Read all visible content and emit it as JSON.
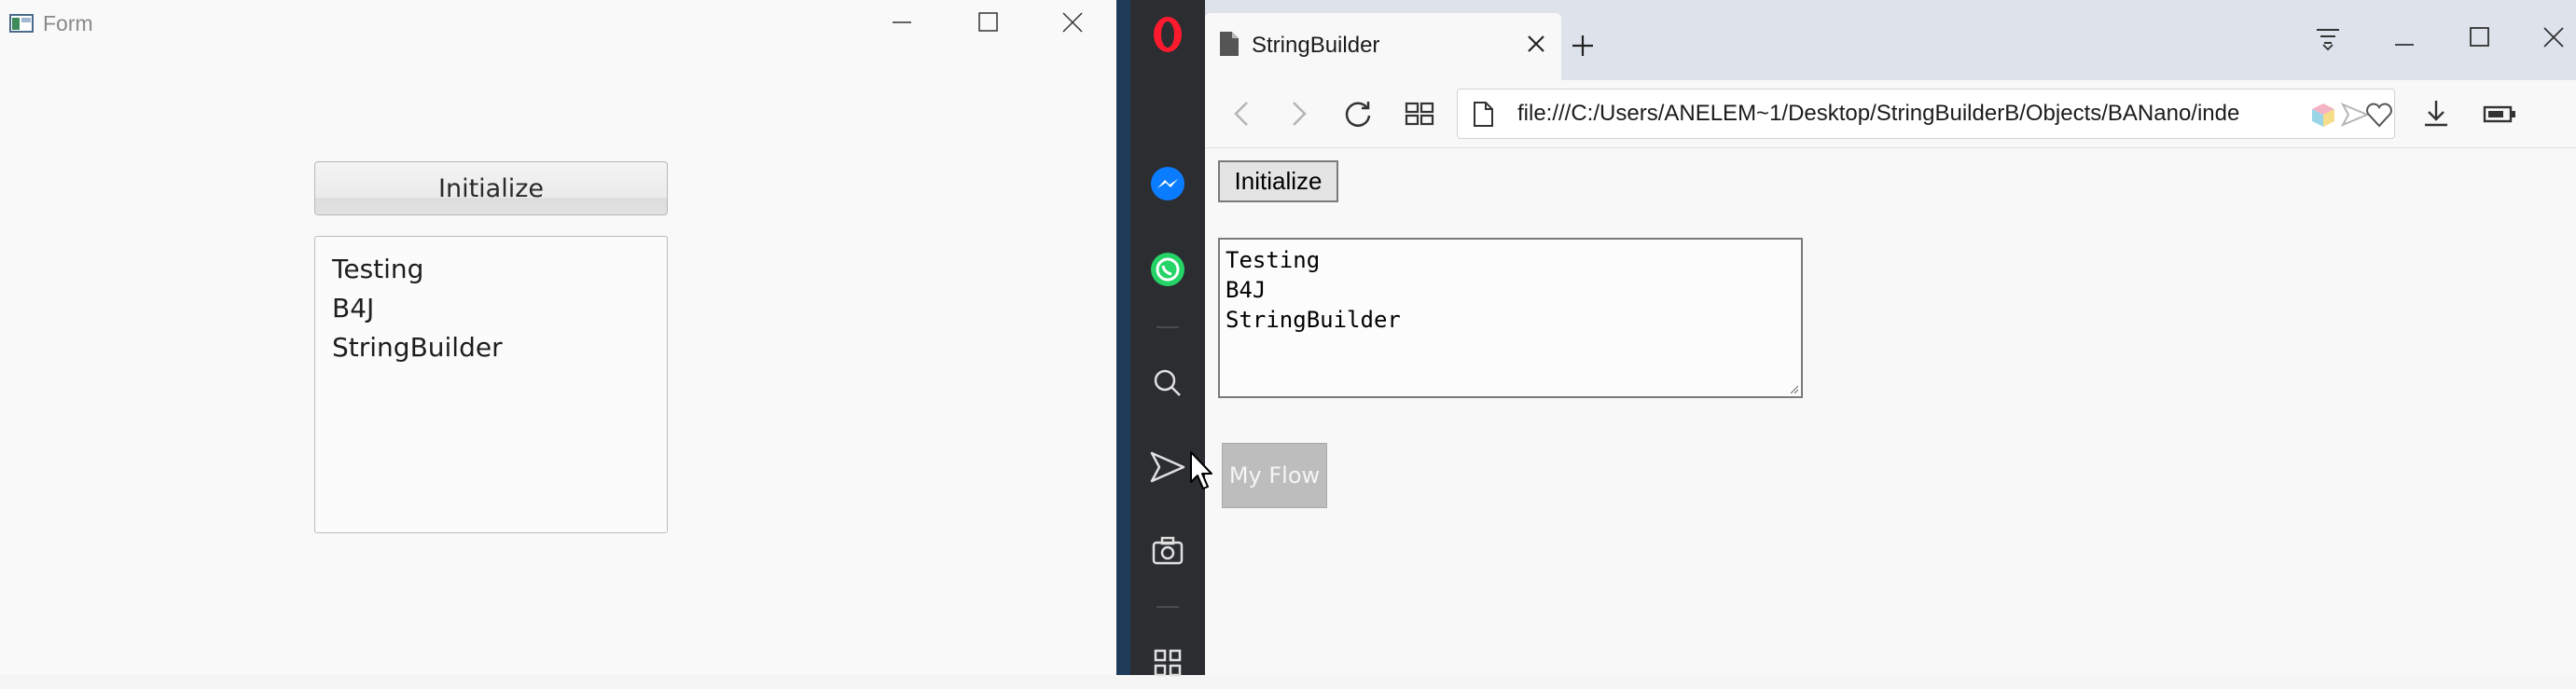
{
  "form_window": {
    "title": "Form",
    "initialize_label": "Initialize",
    "textarea_lines": [
      "Testing",
      "B4J",
      "StringBuilder"
    ]
  },
  "browser": {
    "tab_title": "StringBuilder",
    "url": "file:///C:/Users/ANELEM~1/Desktop/StringBuilderB/Objects/BANano/inde",
    "page": {
      "initialize_label": "Initialize",
      "textarea_lines": [
        "Testing",
        "B4J",
        "StringBuilder"
      ],
      "myflow_label": "My Flow"
    }
  },
  "opera_sidebar": {
    "icons": [
      "opera-logo-icon",
      "messenger-icon",
      "whatsapp-icon",
      "search-icon",
      "send-icon",
      "camera-icon",
      "grid-icon"
    ]
  },
  "colors": {
    "sidebar_bg": "#2b2d31",
    "opera_red": "#ff1b2d",
    "messenger_blue": "#0a7cff",
    "whatsapp_green": "#25d366",
    "tabbar_bg": "#dde2eb"
  }
}
